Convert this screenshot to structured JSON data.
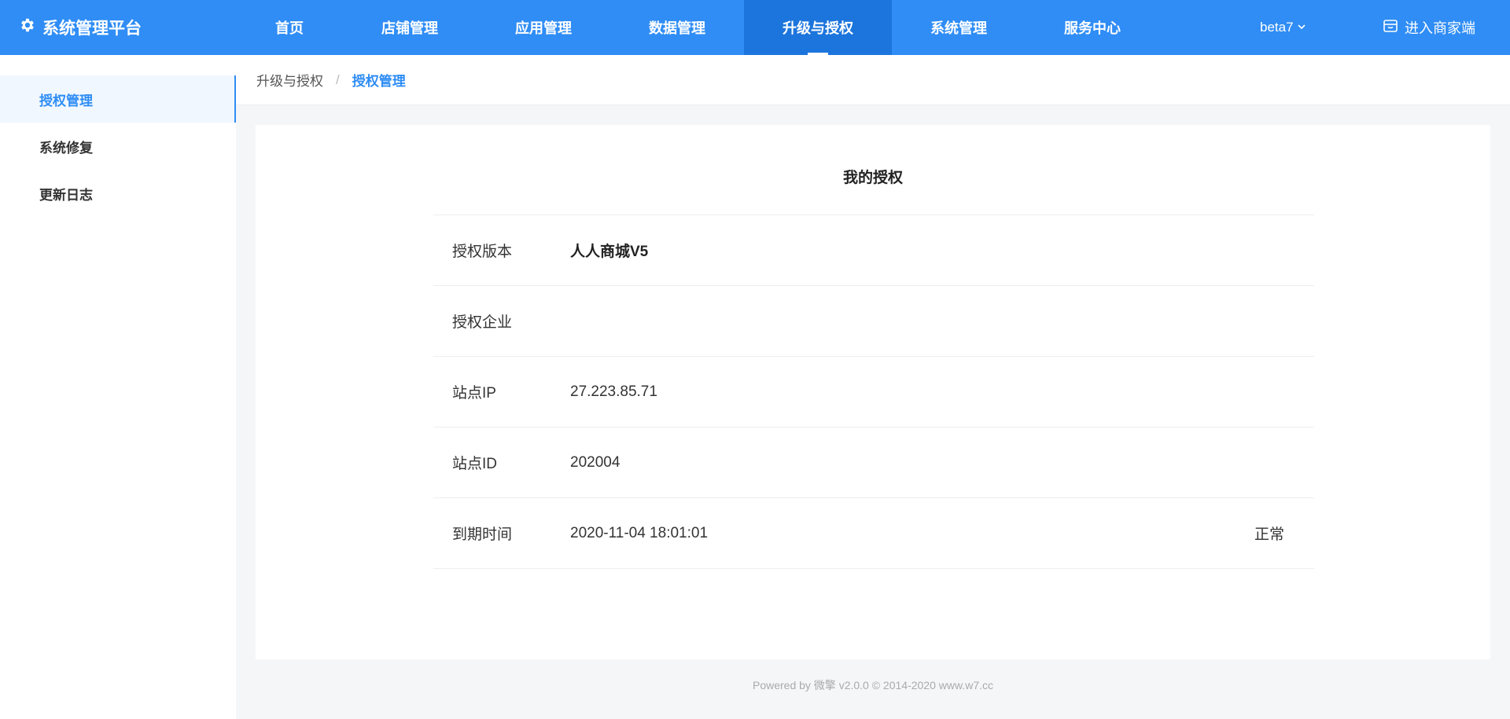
{
  "app": {
    "title": "系统管理平台"
  },
  "nav": {
    "items": [
      {
        "label": "首页",
        "active": false
      },
      {
        "label": "店铺管理",
        "active": false
      },
      {
        "label": "应用管理",
        "active": false
      },
      {
        "label": "数据管理",
        "active": false
      },
      {
        "label": "升级与授权",
        "active": true
      },
      {
        "label": "系统管理",
        "active": false
      },
      {
        "label": "服务中心",
        "active": false
      }
    ],
    "version": "beta7",
    "merchant_link": "进入商家端"
  },
  "sidebar": {
    "items": [
      {
        "label": "授权管理",
        "active": true
      },
      {
        "label": "系统修复",
        "active": false
      },
      {
        "label": "更新日志",
        "active": false
      }
    ]
  },
  "breadcrumb": {
    "parent": "升级与授权",
    "separator": "/",
    "current": "授权管理"
  },
  "license": {
    "title": "我的授权",
    "rows": [
      {
        "label": "授权版本",
        "value": "人人商城V5",
        "status": ""
      },
      {
        "label": "授权企业",
        "value": "",
        "status": ""
      },
      {
        "label": "站点IP",
        "value": "27.223.85.71",
        "status": ""
      },
      {
        "label": "站点ID",
        "value": "202004",
        "status": ""
      },
      {
        "label": "到期时间",
        "value": "2020-11-04 18:01:01",
        "status": "正常"
      }
    ]
  },
  "footer": {
    "text": "Powered by 微擎 v2.0.0 © 2014-2020 www.w7.cc"
  },
  "colors": {
    "primary": "#2f8df5",
    "nav_active": "#1c75dd"
  },
  "icons": {
    "brand": "gear-icon",
    "version": "chevron-down-icon",
    "merchant": "store-icon"
  }
}
